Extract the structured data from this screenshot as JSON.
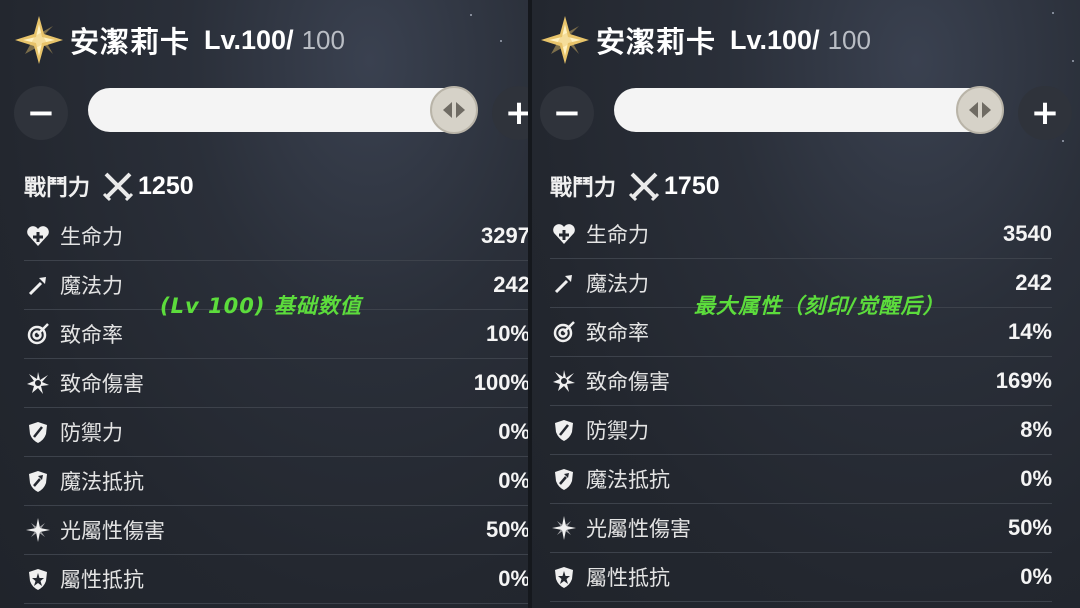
{
  "character": {
    "name": "安潔莉卡"
  },
  "panels": [
    {
      "level": "Lv.100/",
      "level_max": "100",
      "combat_power_label": "戰鬥力",
      "combat_power": "1250",
      "overlay": "(Lv 100) 基础数值",
      "stats": [
        {
          "icon": "heart-icon",
          "label": "生命力",
          "value": "3297"
        },
        {
          "icon": "wand-icon",
          "label": "魔法力",
          "value": "242"
        },
        {
          "icon": "crit-rate-icon",
          "label": "致命率",
          "value": "10%"
        },
        {
          "icon": "crit-damage-icon",
          "label": "致命傷害",
          "value": "100%"
        },
        {
          "icon": "shield-icon",
          "label": "防禦力",
          "value": "0%"
        },
        {
          "icon": "magic-resist-icon",
          "label": "魔法抵抗",
          "value": "0%"
        },
        {
          "icon": "light-damage-icon",
          "label": "光屬性傷害",
          "value": "50%"
        },
        {
          "icon": "element-resist-icon",
          "label": "屬性抵抗",
          "value": "0%"
        }
      ]
    },
    {
      "level": "Lv.100/",
      "level_max": "100",
      "combat_power_label": "戰鬥力",
      "combat_power": "1750",
      "overlay": "最大属性（刻印/觉醒后）",
      "stats": [
        {
          "icon": "heart-icon",
          "label": "生命力",
          "value": "3540"
        },
        {
          "icon": "wand-icon",
          "label": "魔法力",
          "value": "242"
        },
        {
          "icon": "crit-rate-icon",
          "label": "致命率",
          "value": "14%"
        },
        {
          "icon": "crit-damage-icon",
          "label": "致命傷害",
          "value": "169%"
        },
        {
          "icon": "shield-icon",
          "label": "防禦力",
          "value": "8%"
        },
        {
          "icon": "magic-resist-icon",
          "label": "魔法抵抗",
          "value": "0%"
        },
        {
          "icon": "light-damage-icon",
          "label": "光屬性傷害",
          "value": "50%"
        },
        {
          "icon": "element-resist-icon",
          "label": "屬性抵抗",
          "value": "0%"
        }
      ]
    }
  ],
  "controls": {
    "minus": "−",
    "plus": "+"
  },
  "slider": {
    "level_fraction": 1.0
  },
  "colors": {
    "overlay_text": "#5cdc3c",
    "emblem": "#e8c46a",
    "background": "#23272f"
  }
}
